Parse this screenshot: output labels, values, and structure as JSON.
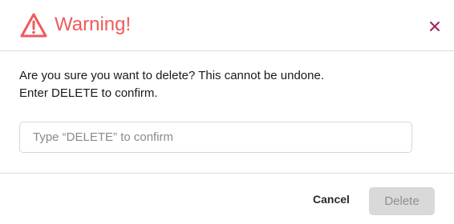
{
  "dialog": {
    "title": "Warning!",
    "icons": {
      "warning": "warning-triangle-icon",
      "close": "close-icon"
    },
    "colors": {
      "title": "#f05a5b",
      "close": "#a0245e",
      "delete_disabled_bg": "#d9d9d9",
      "delete_disabled_text": "#8f8f8f"
    },
    "message_line1": "Are you sure you want to delete? This cannot be undone.",
    "message_line2": "Enter DELETE to confirm.",
    "input": {
      "placeholder": "Type “DELETE” to confirm",
      "value": ""
    },
    "buttons": {
      "cancel": "Cancel",
      "delete": "Delete",
      "delete_disabled": true
    }
  }
}
